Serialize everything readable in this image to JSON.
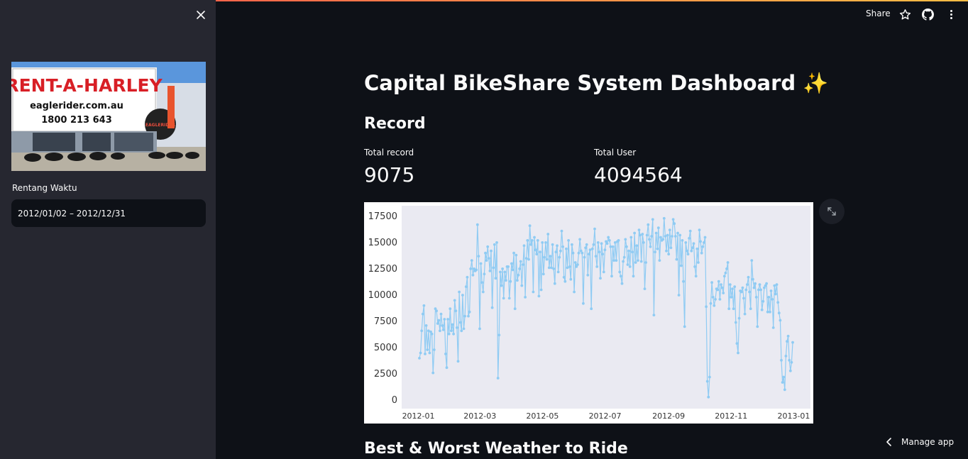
{
  "app": {
    "share_label": "Share",
    "manage_label": "Manage app",
    "icons": [
      "close-icon",
      "star-icon",
      "github-icon",
      "more-vert-icon",
      "chevron-left-icon",
      "expand-icon"
    ]
  },
  "sidebar": {
    "logo_sign_text": "RENT-A-HARLEY",
    "logo_web_text": "eaglerider.com.au",
    "logo_phone_text": "1800 213 643",
    "logo_brand_text": "EAGLERIDER",
    "range_label": "Rentang Waktu",
    "range_value": "2012/01/02 – 2012/12/31"
  },
  "main": {
    "title": "Capital BikeShare System Dashboard",
    "title_emoji": "✨",
    "record_heading": "Record",
    "metric_1_label": "Total record",
    "metric_1_value": "9075",
    "metric_2_label": "Total User",
    "metric_2_value": "4094564",
    "weather_heading": "Best & Worst Weather to Ride"
  },
  "colors": {
    "line": "#8fcbf3",
    "plot_bg": "#eaeaf2",
    "accent_red": "#ff4b4b"
  },
  "chart_data": {
    "type": "line",
    "x_ticks": [
      "2012-01",
      "2012-03",
      "2012-05",
      "2012-07",
      "2012-09",
      "2012-11",
      "2013-01"
    ],
    "y_ticks": [
      "0",
      "2500",
      "5000",
      "7500",
      "10000",
      "12500",
      "15000",
      "17500"
    ],
    "ylim": [
      -800,
      18500
    ],
    "x_start": "2012-01-02",
    "x_end": "2012-12-31",
    "series": [
      {
        "values": [
          4000,
          4500,
          6600,
          8200,
          9000,
          4400,
          7100,
          4800,
          6600,
          4500,
          6500,
          6300,
          2600,
          4800,
          8700,
          8500,
          7300,
          7600,
          6600,
          8200,
          7100,
          6700,
          7700,
          4400,
          3100,
          7700,
          6300,
          8700,
          6600,
          7200,
          6300,
          9500,
          8500,
          6900,
          3700,
          10300,
          7400,
          6600,
          10000,
          6800,
          8000,
          10800,
          11700,
          8000,
          8400,
          12500,
          13300,
          11900,
          12500,
          12300,
          12400,
          16700,
          13700,
          6800,
          13000,
          11200,
          10300,
          12000,
          14000,
          13300,
          14600,
          13500,
          12300,
          14200,
          8800,
          12600,
          14800,
          11600,
          15000,
          2100,
          6200,
          12200,
          10900,
          12500,
          9700,
          12200,
          11400,
          12700,
          12700,
          9700,
          11300,
          13000,
          12400,
          14000,
          8700,
          13800,
          11400,
          11900,
          12500,
          13200,
          10900,
          12900,
          14700,
          9800,
          13500,
          15200,
          13400,
          16600,
          14800,
          15200,
          10300,
          15500,
          14300,
          13900,
          15200,
          9900,
          14100,
          10500,
          15000,
          12000,
          13600,
          15000,
          13400,
          15800,
          12600,
          13700,
          12600,
          14800,
          12500,
          11100,
          14100,
          14700,
          12200,
          13600,
          14200,
          16100,
          14600,
          11700,
          11300,
          14400,
          12600,
          15200,
          12700,
          11500,
          14800,
          14000,
          10300,
          13100,
          12700,
          12900,
          14000,
          15300,
          14200,
          14000,
          9200,
          13600,
          14500,
          14800,
          11900,
          13900,
          14300,
          8700,
          14400,
          14800,
          16300,
          13700,
          12700,
          15000,
          14100,
          11600,
          14900,
          13900,
          12200,
          14300,
          15100,
          14900,
          15500,
          15200,
          14600,
          11800,
          14600,
          13300,
          15000,
          13300,
          15100,
          15200,
          12200,
          11800,
          11100,
          13200,
          13600,
          15300,
          14600,
          12900,
          14200,
          12700,
          15500,
          14100,
          11800,
          15900,
          13100,
          14700,
          13300,
          16200,
          15700,
          13200,
          15800,
          15000,
          10600,
          13100,
          15700,
          16700,
          15300,
          14600,
          15600,
          17200,
          8100,
          14100,
          15900,
          14400,
          16400,
          13300,
          15500,
          15200,
          15300,
          17300,
          15600,
          14200,
          15700,
          13900,
          16200,
          14500,
          15600,
          17200,
          16800,
          15600,
          13400,
          15900,
          10000,
          15700,
          12800,
          15200,
          11300,
          7000,
          15000,
          14200,
          13900,
          15400,
          16100,
          14200,
          14500,
          14900,
          12700,
          11800,
          14400,
          13100,
          16200,
          15100,
          14000,
          14600,
          15000,
          15500,
          8900,
          1800,
          300,
          2200,
          9200,
          11200,
          9800,
          9000,
          9600,
          10600,
          10500,
          11300,
          9600,
          11000,
          10700,
          10200,
          11800,
          12100,
          12500,
          13100,
          8700,
          11000,
          9800,
          10600,
          8700,
          10800,
          7400,
          5400,
          4500,
          7800,
          10400,
          10300,
          10700,
          9700,
          8200,
          10500,
          11000,
          11700,
          10300,
          8700,
          13300,
          11500,
          10700,
          11100,
          9800,
          7000,
          10500,
          11000,
          10500,
          8600,
          9400,
          10700,
          10900,
          11100,
          8400,
          9800,
          8400,
          10400,
          9600,
          6900,
          10900,
          10100,
          11000,
          9300,
          8300,
          7600,
          3800,
          1700,
          2200,
          1000,
          4200,
          5600,
          6100,
          3800,
          2800,
          3600,
          5500
        ],
        "name": ""
      }
    ]
  }
}
